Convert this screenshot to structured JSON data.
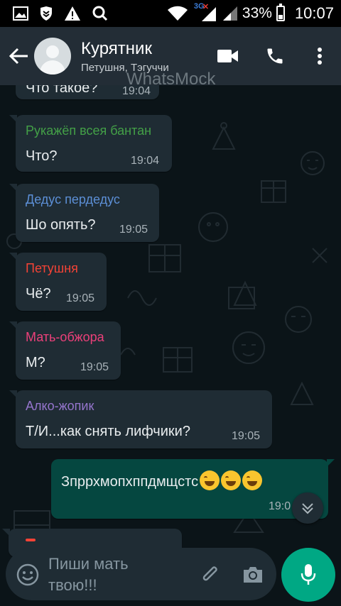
{
  "statusbar": {
    "network_tag": "3G",
    "network_no_data": "✕",
    "battery_percent": "33%",
    "battery_level": 0.33,
    "time": "10:07",
    "icons": [
      "gallery-icon",
      "shield-icon",
      "warning-icon",
      "search-icon",
      "wifi-icon",
      "signal-icon",
      "battery-icon"
    ]
  },
  "header": {
    "title": "Курятник",
    "subtitle": "Петушня, Тэгуччи",
    "watermark": "WhatsMock"
  },
  "messages": [
    {
      "text": "Что такое?",
      "time": "19:04"
    },
    {
      "sender": "Рукажёп всея бантан",
      "sender_color": "#43a047",
      "text": "Что?",
      "time": "19:04"
    },
    {
      "sender": "Дедус пердедус",
      "sender_color": "#5c8fd6",
      "text": "Шо опять?",
      "time": "19:05"
    },
    {
      "sender": "Петушня",
      "sender_color": "#f44336",
      "text": "Чё?",
      "time": "19:05"
    },
    {
      "sender": "Мать-обжора",
      "sender_color": "#ec407a",
      "text": "М?",
      "time": "19:05"
    },
    {
      "sender": "Алко-жопик",
      "sender_color": "#9575cd",
      "text": "Т/И...как снять лифчики?",
      "time": "19:05"
    },
    {
      "outgoing": true,
      "text": "Зпррхмопхппдмщстс",
      "emoji_count": 3,
      "emoji": "face-with-tears-of-joy",
      "time": "19:0"
    }
  ],
  "composer": {
    "placeholder": "Пиши мать\nтвою!!!"
  },
  "colors": {
    "appbar": "#232d36",
    "incoming_bubble": "#1f2c34",
    "outgoing_bubble": "#054740",
    "accent": "#00a884"
  }
}
